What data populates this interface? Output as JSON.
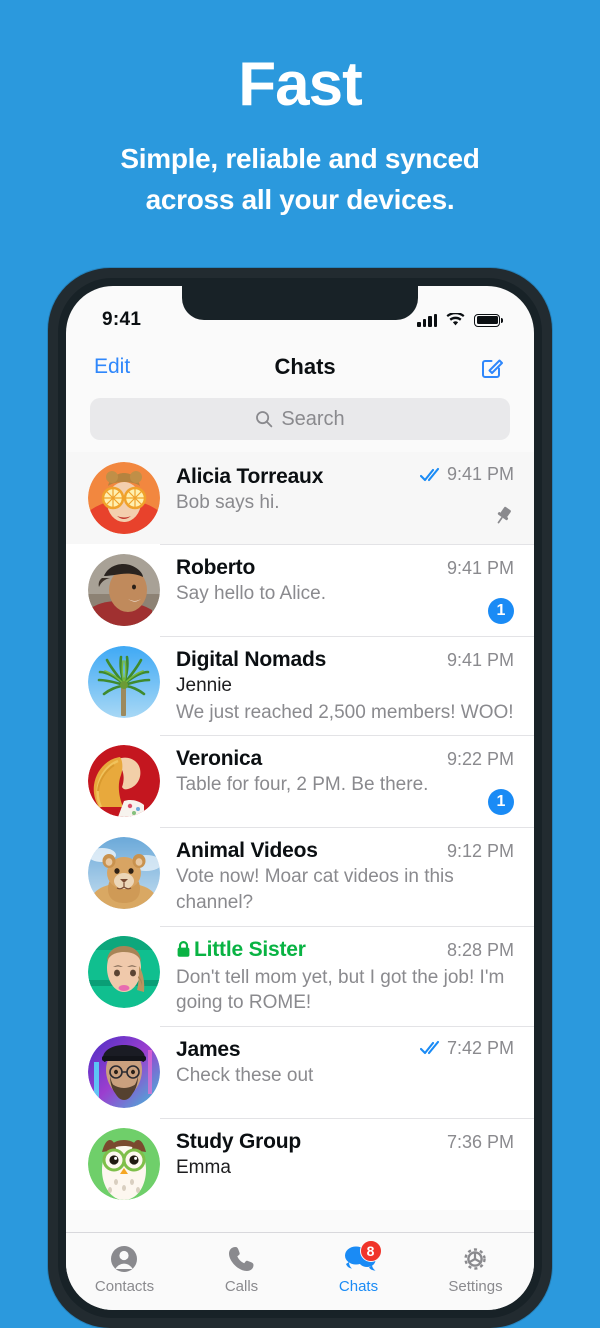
{
  "hero": {
    "title": "Fast",
    "subtitle_line1": "Simple, reliable and synced",
    "subtitle_line2": "across all your devices."
  },
  "colors": {
    "background": "#2b99dd",
    "accent_blue": "#1a8bf5",
    "link_blue": "#2f87fb",
    "secret_green": "#09b343",
    "badge_red": "#f0342a",
    "muted_text": "#8a8a8e"
  },
  "status_bar": {
    "time": "9:41",
    "signal_icon": "cellular-bars-icon",
    "wifi_icon": "wifi-icon",
    "battery_icon": "battery-full-icon"
  },
  "navbar": {
    "left_label": "Edit",
    "title": "Chats",
    "right_icon": "compose-icon"
  },
  "search": {
    "placeholder": "Search",
    "icon": "search-icon"
  },
  "chats": [
    {
      "name": "Alicia Torreaux",
      "sender": "",
      "preview": "Bob says hi.",
      "time": "9:41 PM",
      "read_receipt": "double-check-icon",
      "badge": "",
      "pinned": true,
      "secret": false,
      "avatar": "avatar-alicia"
    },
    {
      "name": "Roberto",
      "sender": "",
      "preview": "Say hello to Alice.",
      "time": "9:41 PM",
      "read_receipt": "",
      "badge": "1",
      "pinned": false,
      "secret": false,
      "avatar": "avatar-roberto"
    },
    {
      "name": "Digital Nomads",
      "sender": "Jennie",
      "preview": "We just reached 2,500 members! WOO!",
      "time": "9:41 PM",
      "read_receipt": "",
      "badge": "",
      "pinned": false,
      "secret": false,
      "avatar": "avatar-digital-nomads"
    },
    {
      "name": "Veronica",
      "sender": "",
      "preview": "Table for four, 2 PM. Be there.",
      "time": "9:22 PM",
      "read_receipt": "",
      "badge": "1",
      "pinned": false,
      "secret": false,
      "avatar": "avatar-veronica"
    },
    {
      "name": "Animal Videos",
      "sender": "",
      "preview": "Vote now! Moar cat videos in this channel?",
      "time": "9:12 PM",
      "read_receipt": "",
      "badge": "",
      "pinned": false,
      "secret": false,
      "avatar": "avatar-animal-videos"
    },
    {
      "name": "Little Sister",
      "sender": "",
      "preview": "Don't tell mom yet, but I got the job! I'm going to ROME!",
      "time": "8:28 PM",
      "read_receipt": "",
      "badge": "",
      "pinned": false,
      "secret": true,
      "avatar": "avatar-little-sister"
    },
    {
      "name": "James",
      "sender": "",
      "preview": "Check these out",
      "time": "7:42 PM",
      "read_receipt": "double-check-icon",
      "badge": "",
      "pinned": false,
      "secret": false,
      "avatar": "avatar-james"
    },
    {
      "name": "Study Group",
      "sender": "Emma",
      "preview": "",
      "time": "7:36 PM",
      "read_receipt": "",
      "badge": "",
      "pinned": false,
      "secret": false,
      "avatar": "avatar-study-group"
    }
  ],
  "tabbar": {
    "items": [
      {
        "label": "Contacts",
        "icon": "person-icon",
        "active": false,
        "badge": ""
      },
      {
        "label": "Calls",
        "icon": "phone-icon",
        "active": false,
        "badge": ""
      },
      {
        "label": "Chats",
        "icon": "chat-bubbles-icon",
        "active": true,
        "badge": "8"
      },
      {
        "label": "Settings",
        "icon": "gear-icon",
        "active": false,
        "badge": ""
      }
    ]
  }
}
